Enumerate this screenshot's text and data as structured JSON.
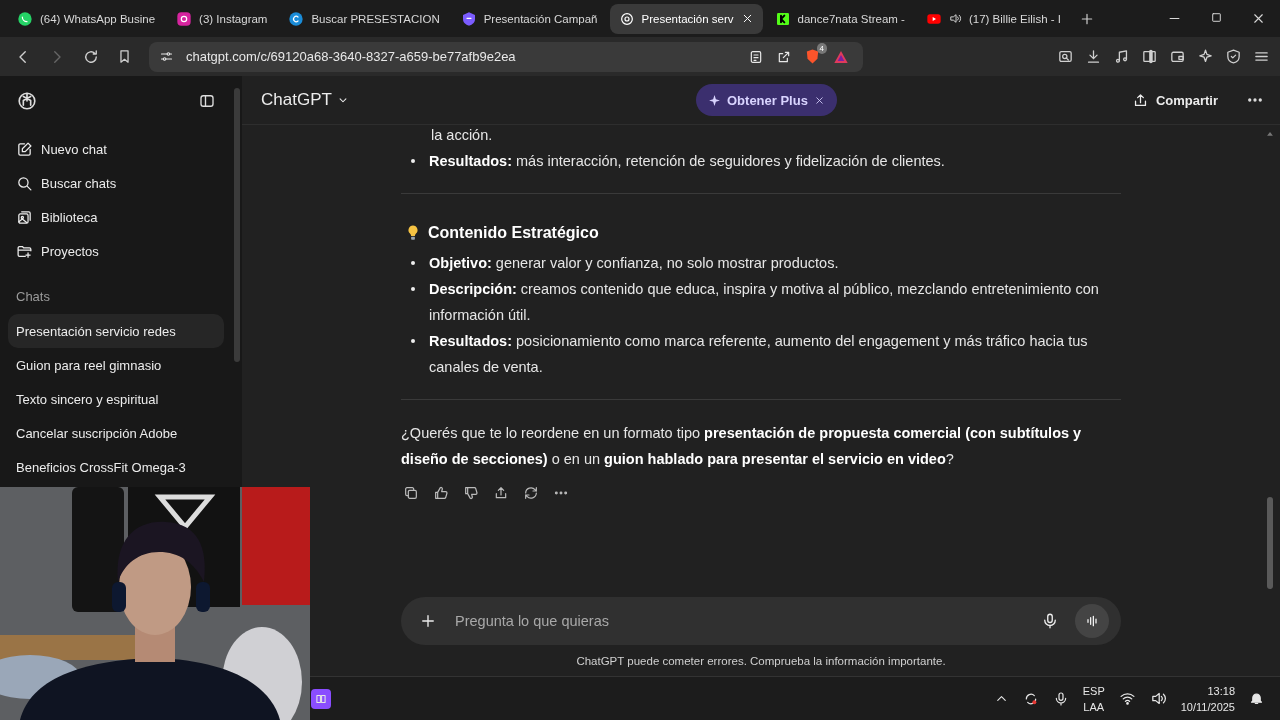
{
  "browser_tabs": [
    {
      "kind": "whatsapp",
      "title": "(64) WhatsApp Busine",
      "selected": false,
      "audio": false
    },
    {
      "kind": "instagram",
      "title": "(3) Instagram",
      "selected": false,
      "audio": false
    },
    {
      "kind": "canva",
      "title": "Buscar PRESESTACION",
      "selected": false,
      "audio": false
    },
    {
      "kind": "shield",
      "title": "Presentación Campañ",
      "selected": false,
      "audio": false
    },
    {
      "kind": "chatgpt",
      "title": "Presentación serv",
      "selected": true,
      "audio": false
    },
    {
      "kind": "kick",
      "title": "dance7nata Stream -",
      "selected": false,
      "audio": false
    },
    {
      "kind": "youtube",
      "title": "(17) Billie Eilish - I",
      "selected": false,
      "audio": true
    }
  ],
  "address_bar": {
    "url": "chatgpt.com/c/69120a68-3640-8327-a659-be77afb9e2ea",
    "shield_count": "4"
  },
  "sidebar": {
    "nav_items": [
      {
        "kind": "edit",
        "label": "Nuevo chat"
      },
      {
        "kind": "search",
        "label": "Buscar chats"
      },
      {
        "kind": "library",
        "label": "Biblioteca"
      },
      {
        "kind": "folder",
        "label": "Proyectos"
      }
    ],
    "section_title": "Chats",
    "chats": [
      {
        "label": "Presentación servicio redes",
        "selected": true
      },
      {
        "label": "Guion para reel gimnasio",
        "selected": false
      },
      {
        "label": "Texto sincero y espiritual",
        "selected": false
      },
      {
        "label": "Cancelar suscripción Adobe",
        "selected": false
      },
      {
        "label": "Beneficios CrossFit Omega-3",
        "selected": false
      }
    ]
  },
  "header": {
    "model": "ChatGPT",
    "promo": "Obtener Plus",
    "share": "Compartir"
  },
  "message": [
    {
      "kind": "continuation",
      "text": "la acción."
    },
    {
      "kind": "bullet",
      "text": "**Resultados:** más interacción, retención de seguidores y fidelización de clientes."
    },
    {
      "kind": "divider"
    },
    {
      "kind": "heading",
      "text": "Contenido Estratégico"
    },
    {
      "kind": "bullet",
      "text": "**Objetivo:** generar valor y confianza, no solo mostrar productos."
    },
    {
      "kind": "bullet",
      "text": "**Descripción:** creamos contenido que educa, inspira y motiva al público, mezclando entretenimiento con información útil."
    },
    {
      "kind": "bullet",
      "text": "**Resultados:** posicionamiento como marca referente, aumento del engagement y más tráfico hacia tus canales de venta."
    },
    {
      "kind": "divider"
    },
    {
      "kind": "paragraph",
      "text": "¿Querés que te lo reordene en un formato tipo **presentación de propuesta comercial (con subtítulos y diseño de secciones)** o en un **guion hablado para presentar el servicio en video**?"
    }
  ],
  "composer": {
    "placeholder": "Pregunta lo que quieras"
  },
  "disclaimer": "ChatGPT puede cometer errores. Comprueba la información importante.",
  "taskbar": {
    "language": "ESP",
    "layout": "LAA",
    "time": "13:18",
    "date": "10/11/2025"
  }
}
